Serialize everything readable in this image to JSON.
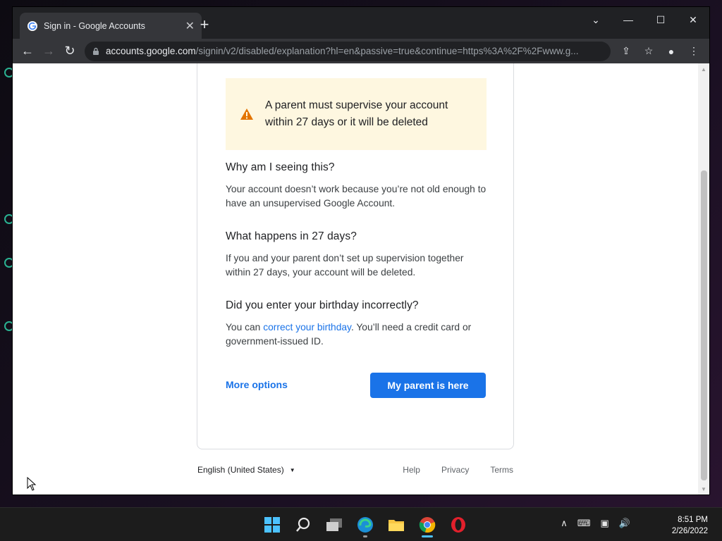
{
  "browser": {
    "tab_title": "Sign in - Google Accounts",
    "url_host": "accounts.google.com",
    "url_path": "/signin/v2/disabled/explanation?hl=en&passive=true&continue=https%3A%2F%2Fwww.g...",
    "new_tab_label": "+",
    "close_tab_label": "✕",
    "window_controls": {
      "dropdown": "⌄",
      "minimize": "—",
      "maximize": "☐",
      "close": "✕"
    }
  },
  "page": {
    "alert_text": "A parent must supervise your account within 27 days or it will be deleted",
    "sections": [
      {
        "heading": "Why am I seeing this?",
        "body": "Your account doesn’t work because you’re not old enough to have an unsupervised Google Account."
      },
      {
        "heading": "What happens in 27 days?",
        "body": "If you and your parent don’t set up supervision together within 27 days, your account will be deleted."
      },
      {
        "heading": "Did you enter your birthday incorrectly?",
        "body_prefix": "You can ",
        "body_link": "correct your birthday",
        "body_suffix": ". You’ll need a credit card or government-issued ID."
      }
    ],
    "more_options_label": "More options",
    "primary_button_label": "My parent is here"
  },
  "footer": {
    "language": "English (United States)",
    "links": [
      "Help",
      "Privacy",
      "Terms"
    ]
  },
  "taskbar": {
    "icons": [
      "windows-start-icon",
      "search-icon",
      "task-view-icon",
      "edge-icon",
      "file-explorer-icon",
      "chrome-icon",
      "opera-icon"
    ],
    "time": "8:51 PM",
    "date": "2/26/2022"
  },
  "colors": {
    "accent": "#1a73e8",
    "alert_bg": "#fef7e0",
    "warning": "#e37400"
  }
}
